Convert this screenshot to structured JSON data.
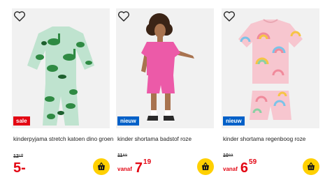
{
  "products": [
    {
      "title": "kinderpyjama stretch katoen dino groen",
      "badge": "sale",
      "badge_color": "#e30613",
      "old_price": "12⁵⁰",
      "vanaf": "",
      "price_main": "5",
      "price_cents": "",
      "price_suffix": "-",
      "image_desc_icon": "dino-pyjama-image"
    },
    {
      "title": "kinder shortama badstof roze",
      "badge": "nieuw",
      "badge_color": "#0060c8",
      "old_price": "11⁹⁹",
      "vanaf": "vanaf",
      "price_main": "7",
      "price_cents": "19",
      "price_suffix": "",
      "image_desc_icon": "model-pink-outfit-image"
    },
    {
      "title": "kinder shortama regenboog roze",
      "badge": "nieuw",
      "badge_color": "#0060c8",
      "old_price": "10⁹⁹",
      "vanaf": "vanaf",
      "price_main": "6",
      "price_cents": "59",
      "price_suffix": "",
      "image_desc_icon": "rainbow-shortama-image"
    }
  ],
  "icons": {
    "heart": "heart-icon",
    "cart": "basket-icon"
  },
  "colors": {
    "price": "#e30613",
    "cart_bg": "#ffd000",
    "sale": "#e30613",
    "nieuw": "#0060c8"
  }
}
